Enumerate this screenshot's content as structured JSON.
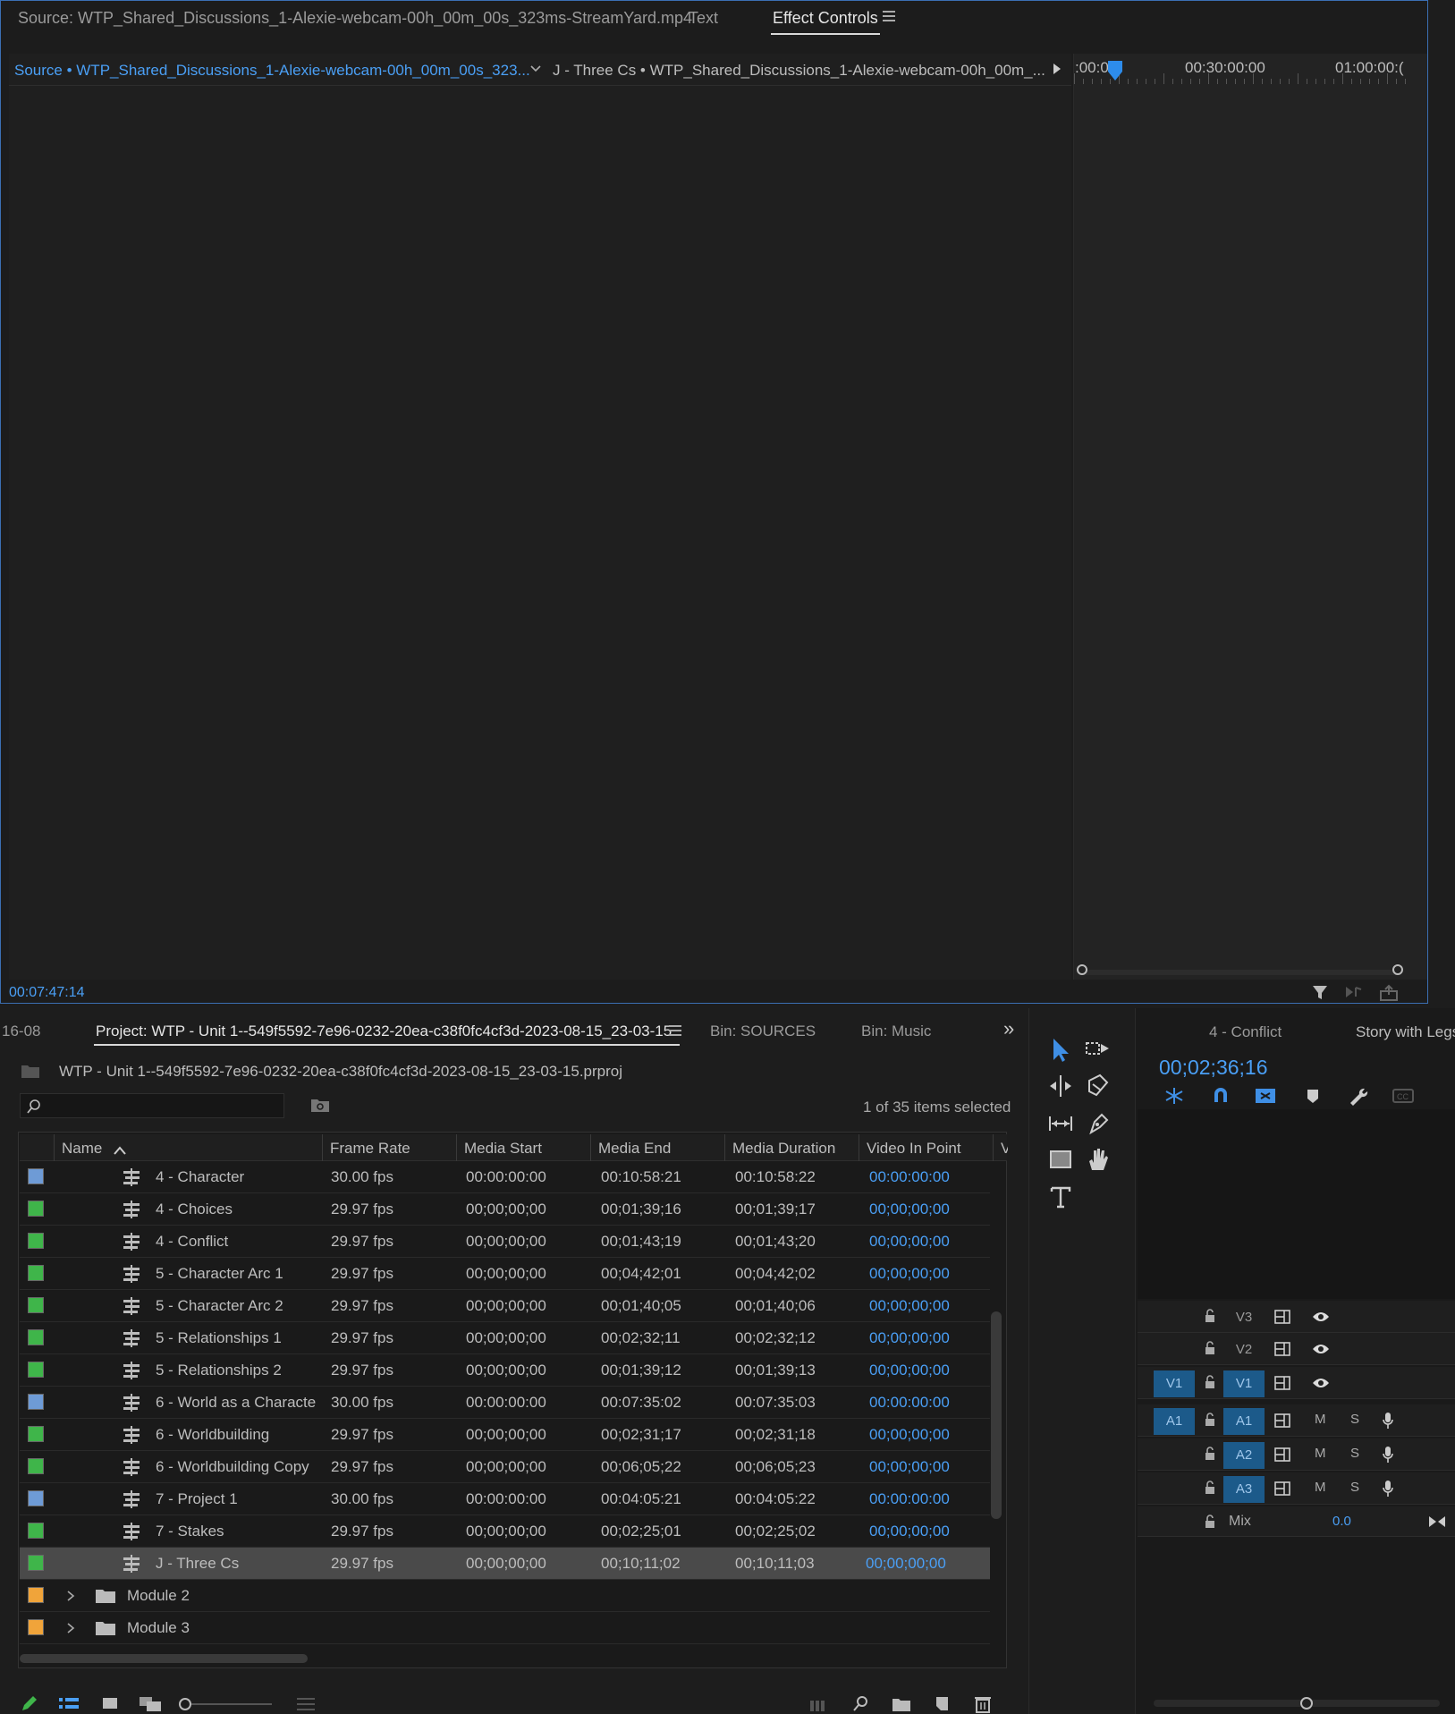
{
  "colors": {
    "accent": "#4a9ff5",
    "chip_blue": "#6e9bd6",
    "chip_green": "#3fb54a",
    "chip_orange": "#f0a43a",
    "track_active": "#1c5a8a"
  },
  "top_tabs": {
    "source": "Source: WTP_Shared_Discussions_1-Alexie-webcam-00h_00m_00s_323ms-StreamYard.mp4",
    "text": "Text",
    "effect_controls": "Effect Controls"
  },
  "effect_controls": {
    "source_label": "Source • WTP_Shared_Discussions_1-Alexie-webcam-00h_00m_00s_323...",
    "sequence_label": "J - Three Cs • WTP_Shared_Discussions_1-Alexie-webcam-00h_00m_...",
    "ruler": [
      ":00:0",
      "00:30:00:00",
      "01:00:00:("
    ],
    "timecode": "00:07:47:14"
  },
  "project_tabs": {
    "left_stub": "16-08",
    "project": "Project: WTP - Unit 1--549f5592-7e96-0232-20ea-c38f0fc4cf3d-2023-08-15_23-03-15",
    "bin_sources": "Bin: SOURCES",
    "bin_music": "Bin: Music",
    "overflow": "»"
  },
  "project": {
    "path": "WTP - Unit 1--549f5592-7e96-0232-20ea-c38f0fc4cf3d-2023-08-15_23-03-15.prproj",
    "selection_status": "1 of 35 items selected",
    "columns": [
      "Name",
      "Frame Rate",
      "Media Start",
      "Media End",
      "Media Duration",
      "Video In Point",
      "V"
    ],
    "rows": [
      {
        "chip": "blue",
        "name": "4 - Character",
        "fps": "30.00 fps",
        "start": "00:00:00:00",
        "end": "00:10:58:21",
        "dur": "00:10:58:22",
        "vin": "00:00:00:00"
      },
      {
        "chip": "green",
        "name": "4 - Choices",
        "fps": "29.97 fps",
        "start": "00;00;00;00",
        "end": "00;01;39;16",
        "dur": "00;01;39;17",
        "vin": "00;00;00;00"
      },
      {
        "chip": "green",
        "name": "4 - Conflict",
        "fps": "29.97 fps",
        "start": "00;00;00;00",
        "end": "00;01;43;19",
        "dur": "00;01;43;20",
        "vin": "00;00;00;00"
      },
      {
        "chip": "green",
        "name": "5 - Character Arc 1",
        "fps": "29.97 fps",
        "start": "00;00;00;00",
        "end": "00;04;42;01",
        "dur": "00;04;42;02",
        "vin": "00;00;00;00"
      },
      {
        "chip": "green",
        "name": "5 - Character Arc 2",
        "fps": "29.97 fps",
        "start": "00;00;00;00",
        "end": "00;01;40;05",
        "dur": "00;01;40;06",
        "vin": "00;00;00;00"
      },
      {
        "chip": "green",
        "name": "5 - Relationships 1",
        "fps": "29.97 fps",
        "start": "00;00;00;00",
        "end": "00;02;32;11",
        "dur": "00;02;32;12",
        "vin": "00;00;00;00"
      },
      {
        "chip": "green",
        "name": "5 - Relationships 2",
        "fps": "29.97 fps",
        "start": "00;00;00;00",
        "end": "00;01;39;12",
        "dur": "00;01;39;13",
        "vin": "00;00;00;00"
      },
      {
        "chip": "blue",
        "name": "6 - World as a Characte",
        "fps": "30.00 fps",
        "start": "00:00:00:00",
        "end": "00:07:35:02",
        "dur": "00:07:35:03",
        "vin": "00:00:00:00"
      },
      {
        "chip": "green",
        "name": "6 - Worldbuilding",
        "fps": "29.97 fps",
        "start": "00;00;00;00",
        "end": "00;02;31;17",
        "dur": "00;02;31;18",
        "vin": "00;00;00;00"
      },
      {
        "chip": "green",
        "name": "6 - Worldbuilding Copy",
        "fps": "29.97 fps",
        "start": "00;00;00;00",
        "end": "00;06;05;22",
        "dur": "00;06;05;23",
        "vin": "00;00;00;00"
      },
      {
        "chip": "blue",
        "name": "7 - Project 1",
        "fps": "30.00 fps",
        "start": "00:00:00:00",
        "end": "00:04:05:21",
        "dur": "00:04:05:22",
        "vin": "00:00:00:00"
      },
      {
        "chip": "green",
        "name": "7 - Stakes",
        "fps": "29.97 fps",
        "start": "00;00;00;00",
        "end": "00;02;25;01",
        "dur": "00;02;25;02",
        "vin": "00;00;00;00"
      },
      {
        "chip": "green",
        "name": "J - Three Cs",
        "fps": "29.97 fps",
        "start": "00;00;00;00",
        "end": "00;10;11;02",
        "dur": "00;10;11;03",
        "vin": "00;00;00;00",
        "selected": true
      }
    ],
    "folders": [
      {
        "chip": "orange",
        "name": "Module 2"
      },
      {
        "chip": "orange",
        "name": "Module 3"
      }
    ]
  },
  "timeline": {
    "tab_active": "4 - Conflict",
    "tab_other": "Story with Legs",
    "timecode": "00;02;36;16",
    "mix_label": "Mix",
    "mix_value": "0.0",
    "tracks": [
      {
        "src": "",
        "name": "V3",
        "type": "video"
      },
      {
        "src": "",
        "name": "V2",
        "type": "video"
      },
      {
        "src": "V1",
        "name": "V1",
        "type": "video"
      },
      {
        "src": "A1",
        "name": "A1",
        "type": "audio"
      },
      {
        "src": "",
        "name": "A2",
        "type": "audio"
      },
      {
        "src": "",
        "name": "A3",
        "type": "audio"
      }
    ],
    "mute_label": "M",
    "solo_label": "S"
  }
}
